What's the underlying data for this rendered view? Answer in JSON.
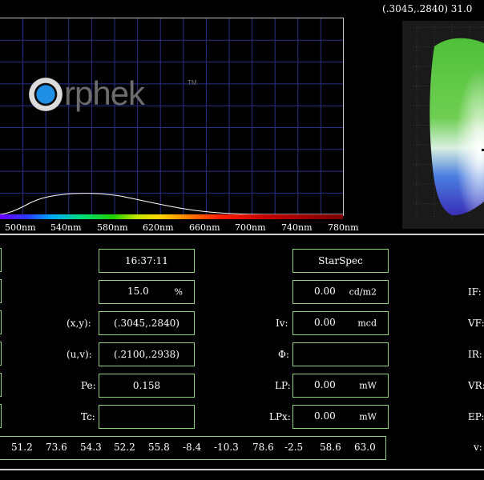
{
  "spectrum": {
    "x_labels": [
      "500nm",
      "540nm",
      "580nm",
      "620nm",
      "660nm",
      "700nm",
      "740nm",
      "780nm"
    ]
  },
  "logo": {
    "text": "rphek",
    "tm": "TM"
  },
  "cie": {
    "readout": "(.3045,.2840) 31.0"
  },
  "fields": {
    "time": "16:37:11",
    "percent_value": "15.0",
    "percent_unit": "%",
    "device": "StarSpec",
    "lum_value": "0.00",
    "lum_unit": "cd/m2",
    "xy_label": "(x,y):",
    "xy_value": "(.3045,.2840)",
    "iv_label": "Iv:",
    "iv_value": "0.00",
    "iv_unit": "mcd",
    "uv_label": "(u,v):",
    "uv_value": "(.2100,.2938)",
    "phi_label": "Φ:",
    "pe_label": "Pe:",
    "pe_value": "0.158",
    "lp_label": "LP:",
    "lp_value": "0.00",
    "lp_unit": "mW",
    "tc_label": "Tc:",
    "lpx_label": "LPx:",
    "lpx_value": "0.00",
    "lpx_unit": "mW"
  },
  "right_labels": {
    "if": "IF:",
    "vf": "VF:",
    "ir": "IR:",
    "vr": "VR:",
    "ep": "EP:",
    "v": "v:"
  },
  "cri_values": [
    "51.2",
    "73.6",
    "54.3",
    "52.2",
    "55.8",
    "-8.4",
    "-10.3",
    "78.6",
    "-2.5",
    "58.6",
    "63.0"
  ]
}
